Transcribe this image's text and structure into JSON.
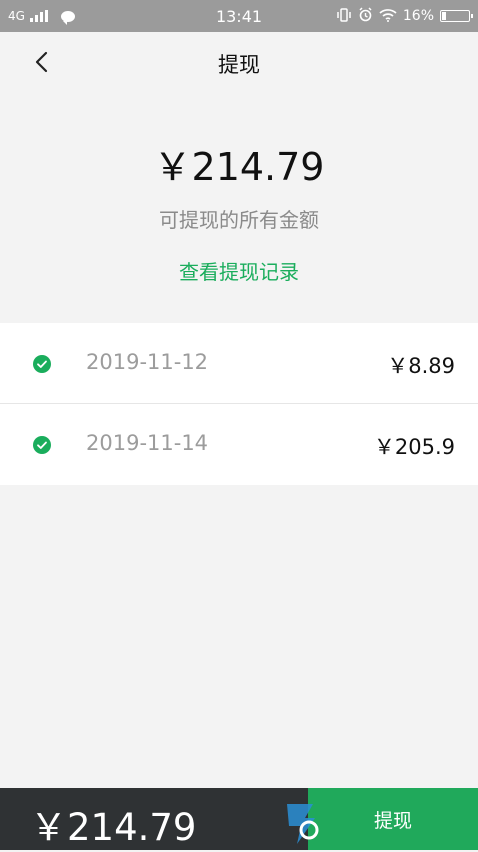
{
  "status_bar": {
    "network": "4G",
    "time": "13:41",
    "battery": "16%",
    "battery_level": 0.16,
    "icons": [
      "signal-icon",
      "chat-bubble-icon",
      "vibrate-icon",
      "alarm-icon",
      "wifi-icon",
      "battery-icon"
    ]
  },
  "nav": {
    "title": "提现",
    "back_icon": "chevron-left-icon"
  },
  "summary": {
    "amount": "￥214.79",
    "caption": "可提现的所有金额",
    "history_link": "查看提现记录"
  },
  "records": [
    {
      "date": "2019-11-12",
      "amount": "￥8.89",
      "status_icon": "check-circle-icon"
    },
    {
      "date": "2019-11-14",
      "amount": "￥205.9",
      "status_icon": "check-circle-icon"
    }
  ],
  "bottom_bar": {
    "amount": "￥214.79",
    "button_label": "提现"
  },
  "colors": {
    "accent_green": "#1aad5c",
    "button_green": "#20a95b",
    "bottom_bar_bg": "#2f3234",
    "status_bar_bg": "#9b9b9b"
  }
}
